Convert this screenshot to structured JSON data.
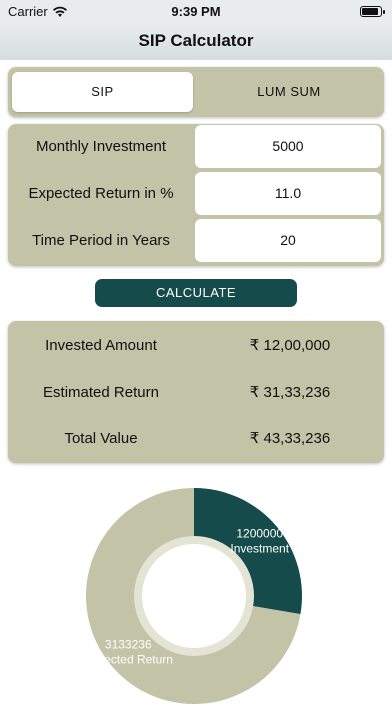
{
  "status_bar": {
    "carrier": "Carrier",
    "time": "9:39 PM"
  },
  "nav": {
    "title": "SIP Calculator"
  },
  "segment": {
    "tabs": [
      "SIP",
      "LUM SUM"
    ],
    "selected": "SIP"
  },
  "inputs": [
    {
      "label": "Monthly Investment",
      "value": "5000"
    },
    {
      "label": "Expected Return in %",
      "value": "11.0"
    },
    {
      "label": "Time Period in Years",
      "value": "20"
    }
  ],
  "calculate_label": "CALCULATE",
  "results": [
    {
      "label": "Invested Amount",
      "value": "₹ 12,00,000"
    },
    {
      "label": "Estimated Return",
      "value": "₹ 31,33,236"
    },
    {
      "label": "Total Value",
      "value": "₹ 43,33,236"
    }
  ],
  "colors": {
    "accent": "#164b4b",
    "panel": "#c2c3a7",
    "ring": "#e3e4d3"
  },
  "chart_data": {
    "type": "pie",
    "slices": [
      {
        "value": 1200000,
        "label": "1200000",
        "sublabel": "Investment",
        "color": "#164b4b"
      },
      {
        "value": 3133236,
        "label": "3133236",
        "sublabel": "Expected Return",
        "color": "#c2c3a7"
      }
    ]
  }
}
